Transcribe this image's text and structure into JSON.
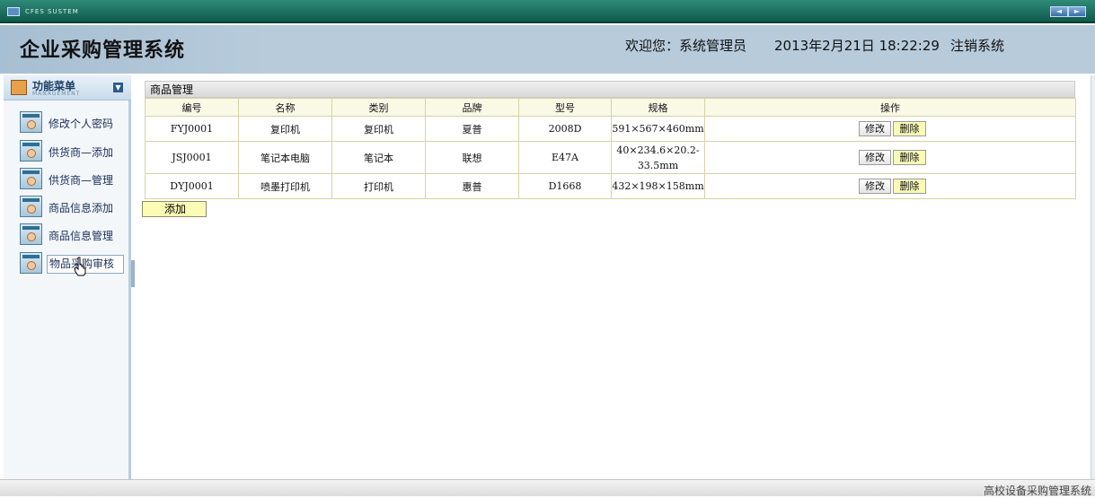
{
  "titlebar": {
    "app_name": "CFES SUSTEM",
    "prev": "◄",
    "next": "►"
  },
  "header": {
    "title": "企业采购管理系统",
    "welcome": "欢迎您：系统管理员",
    "datetime": "2013年2月21日  18:22:29",
    "logout": "注销系统"
  },
  "sidebar": {
    "title": "功能菜单",
    "subtitle": "MANAGEMENT",
    "collapse_icon": "chevron-down-icon",
    "items": [
      {
        "label": "修改个人密码"
      },
      {
        "label": "供货商—添加"
      },
      {
        "label": "供货商—管理"
      },
      {
        "label": "商品信息添加"
      },
      {
        "label": "商品信息管理"
      },
      {
        "label": "物品采购审核"
      }
    ]
  },
  "panel": {
    "title": "商品管理",
    "columns": [
      "编号",
      "名称",
      "类别",
      "品牌",
      "型号",
      "规格",
      "操作"
    ],
    "rows": [
      {
        "id": "FYJ0001",
        "name": "复印机",
        "category": "复印机",
        "brand": "夏普",
        "model": "2008D",
        "spec": "591×567×460mm"
      },
      {
        "id": "JSJ0001",
        "name": "笔记本电脑",
        "category": "笔记本",
        "brand": "联想",
        "model": "E47A",
        "spec": "40×234.6×20.2-33.5mm"
      },
      {
        "id": "DYJ0001",
        "name": "喷墨打印机",
        "category": "打印机",
        "brand": "惠普",
        "model": "D1668",
        "spec": "432×198×158mm"
      }
    ],
    "edit_label": "修改",
    "delete_label": "删除",
    "add_label": "添加"
  },
  "status": {
    "text": "高校设备采购管理系统"
  },
  "colors": {
    "header_bg": "#b7cbdb",
    "titlebar": "#1f6f60",
    "table_border": "#d6d2a6",
    "yellow_button": "#fafab8"
  }
}
